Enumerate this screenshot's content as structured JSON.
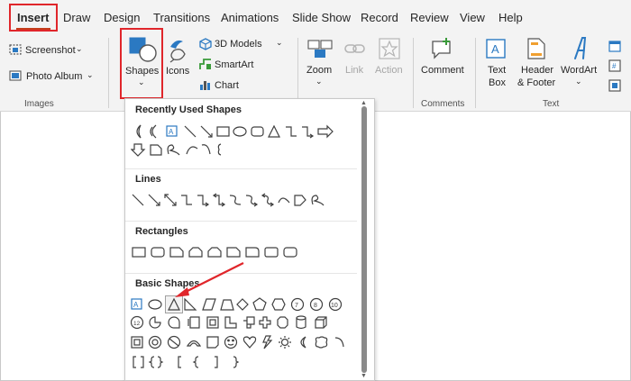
{
  "tabs": [
    {
      "label": "Insert"
    },
    {
      "label": "Draw"
    },
    {
      "label": "Design"
    },
    {
      "label": "Transitions"
    },
    {
      "label": "Animations"
    },
    {
      "label": "Slide Show"
    },
    {
      "label": "Record"
    },
    {
      "label": "Review"
    },
    {
      "label": "View"
    },
    {
      "label": "Help"
    }
  ],
  "ribbon": {
    "images": {
      "screenshot": "Screenshot",
      "photo_album": "Photo Album",
      "group": "Images"
    },
    "illustrations": {
      "shapes": "Shapes",
      "icons": "Icons",
      "models": "3D Models",
      "smartart": "SmartArt",
      "chart": "Chart"
    },
    "links": {
      "zoom": "Zoom",
      "link": "Link",
      "action": "Action"
    },
    "comments": {
      "comment": "Comment",
      "group": "Comments"
    },
    "text": {
      "text_box_1": "Text",
      "text_box_2": "Box",
      "header_1": "Header",
      "header_2": "& Footer",
      "wordart": "WordArt",
      "group": "Text"
    }
  },
  "shapes_menu": {
    "sections": [
      {
        "title": "Recently Used Shapes"
      },
      {
        "title": "Lines"
      },
      {
        "title": "Rectangles"
      },
      {
        "title": "Basic Shapes"
      }
    ],
    "basic_shapes_numbers": [
      "7",
      "8",
      "10",
      "12"
    ]
  },
  "colors": {
    "accent_red": "#e0262b",
    "insert_underline": "#c43e1c",
    "shape_blue": "#2b79c2"
  }
}
